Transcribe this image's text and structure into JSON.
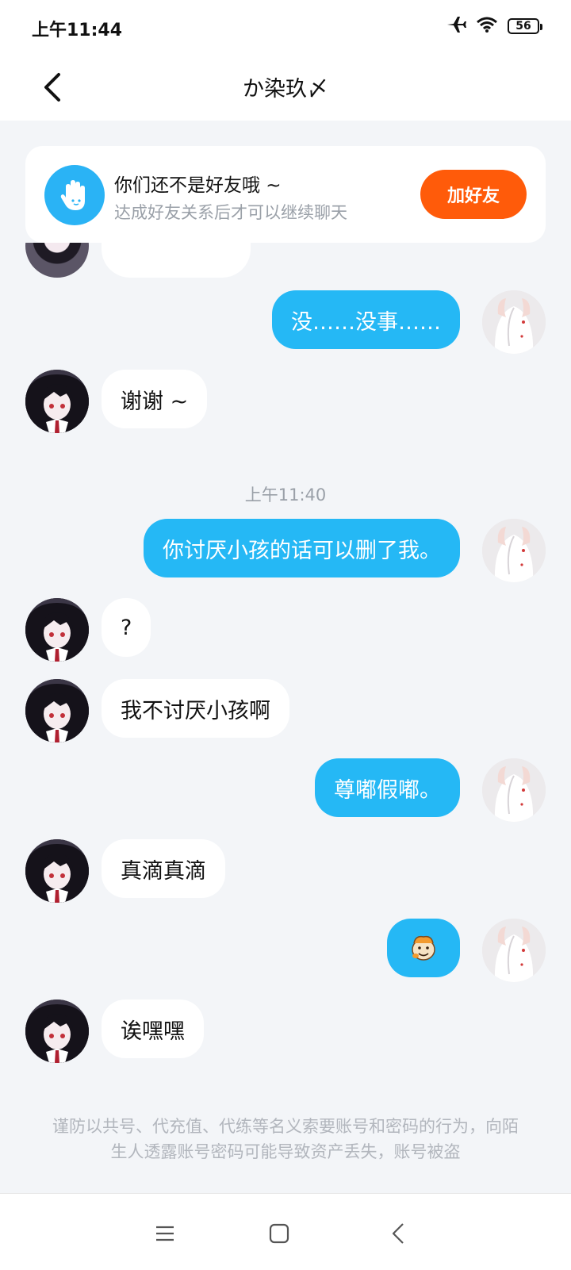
{
  "status": {
    "time": "上午11:44",
    "battery": "56",
    "icons": [
      "airplane-icon",
      "wifi-icon",
      "battery-icon"
    ]
  },
  "header": {
    "title": "か染玖〆",
    "back_icon": "chevron-left-icon"
  },
  "friend_notice": {
    "title": "你们还不是好友哦 ~",
    "subtitle": "达成好友关系后才可以继续聊天",
    "button": "加好友",
    "icon": "hand-icon",
    "button_color": "#ff5b0a"
  },
  "messages": [
    {
      "side": "out",
      "text": "没……没事……"
    },
    {
      "side": "in",
      "text": "谢谢 ~"
    },
    {
      "side": "out",
      "text": "你讨厌小孩的话可以删了我。"
    },
    {
      "side": "in",
      "text": "?"
    },
    {
      "side": "in",
      "text": "我不讨厌小孩啊"
    },
    {
      "side": "out",
      "text": "尊嘟假嘟。"
    },
    {
      "side": "in",
      "text": "真滴真滴"
    },
    {
      "side": "out",
      "text": "",
      "sticker": "emoji-sticker-icon"
    },
    {
      "side": "in",
      "text": "诶嘿嘿"
    }
  ],
  "timestamp": "上午11:40",
  "warning": "谨防以共号、代充值、代练等名义索要账号和密码的行为，向陌生人透露账号密码可能导致资产丢失，账号被盗",
  "bottom_nav": {
    "icons": [
      "menu-icon",
      "home-square-icon",
      "back-triangle-icon"
    ]
  },
  "colors": {
    "out_bubble": "#25b8f5",
    "in_bubble": "#ffffff",
    "background": "#f3f5f8"
  }
}
